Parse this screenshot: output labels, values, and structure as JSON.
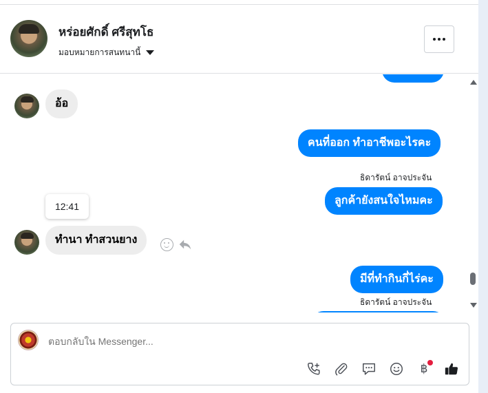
{
  "header": {
    "contact_name": "หร่อยศักดิ์ ศรีสุทโธ",
    "assign_label": "มอบหมายการสนทนานี้",
    "more_label": "···"
  },
  "messages": [
    {
      "direction": "in",
      "text": "อ้อ"
    },
    {
      "direction": "out",
      "text": "คนที่ออก ทำอาชีพอะไรคะ"
    },
    {
      "direction": "out",
      "sender": "ธิดารัตน์ อาจประจัน",
      "text": "ลูกค้ายังสนใจไหมคะ"
    },
    {
      "direction": "in",
      "text": "ทำนา  ทำสวนยาง",
      "tooltip_time": "12:41"
    },
    {
      "direction": "out",
      "text": "มีที่ทำกินกี่ไร่คะ"
    },
    {
      "direction": "out",
      "sender": "ธิดารัตน์ อาจประจัน",
      "text": ""
    }
  ],
  "composer": {
    "placeholder": "ตอบกลับใน Messenger..."
  },
  "tools": {
    "currency_symbol": "฿"
  },
  "colors": {
    "outgoing_bubble": "#0084ff",
    "incoming_bubble": "#ededed",
    "notification_dot": "#e41e3f"
  },
  "icons": [
    "add-call-icon",
    "attachment-icon",
    "saved-reply-icon",
    "emoji-icon",
    "payment-icon",
    "like-icon",
    "reaction-icon",
    "reply-icon",
    "chevron-down-icon"
  ]
}
